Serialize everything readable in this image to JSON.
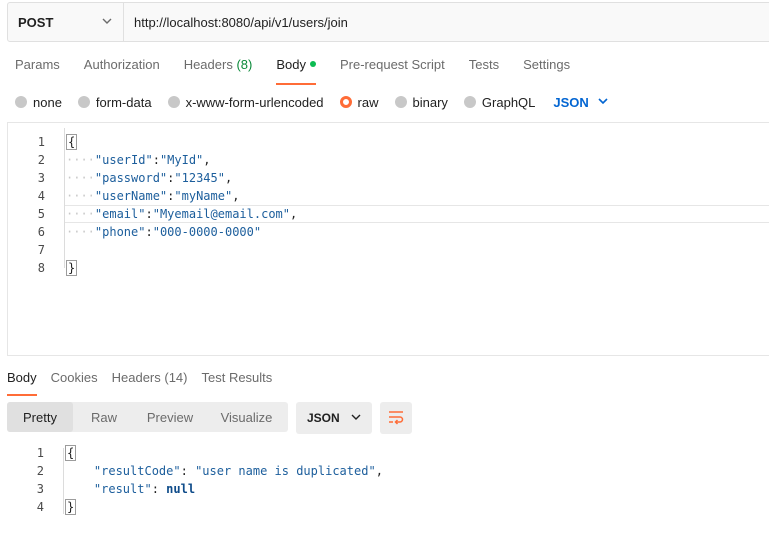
{
  "request": {
    "method": "POST",
    "url": "http://localhost:8080/api/v1/users/join"
  },
  "request_tabs": [
    {
      "label": "Params"
    },
    {
      "label": "Authorization"
    },
    {
      "label": "Headers",
      "count": "(8)"
    },
    {
      "label": "Body",
      "active": true,
      "dot": true
    },
    {
      "label": "Pre-request Script"
    },
    {
      "label": "Tests"
    },
    {
      "label": "Settings"
    }
  ],
  "body_types": [
    {
      "label": "none"
    },
    {
      "label": "form-data"
    },
    {
      "label": "x-www-form-urlencoded"
    },
    {
      "label": "raw",
      "selected": true
    },
    {
      "label": "binary"
    },
    {
      "label": "GraphQL"
    }
  ],
  "body_language": "JSON",
  "request_body": {
    "line_numbers": [
      "1",
      "2",
      "3",
      "4",
      "5",
      "6",
      "7",
      "8"
    ],
    "fields": [
      {
        "key": "\"userId\"",
        "value": "\"MyId\"",
        "comma": ","
      },
      {
        "key": "\"password\"",
        "value": "\"12345\"",
        "comma": ","
      },
      {
        "key": "\"userName\"",
        "value": "\"myName\"",
        "comma": ","
      },
      {
        "key": "\"email\"",
        "value": "\"Myemail@email.com\"",
        "comma": ","
      },
      {
        "key": "\"phone\"",
        "value": "\"000-0000-0000\"",
        "comma": ""
      }
    ],
    "open_brace": "{",
    "close_brace": "}"
  },
  "response_tabs": [
    {
      "label": "Body",
      "active": true
    },
    {
      "label": "Cookies"
    },
    {
      "label": "Headers (14)"
    },
    {
      "label": "Test Results"
    }
  ],
  "view_modes": [
    {
      "label": "Pretty",
      "active": true
    },
    {
      "label": "Raw"
    },
    {
      "label": "Preview"
    },
    {
      "label": "Visualize"
    }
  ],
  "response_format": "JSON",
  "response_body": {
    "line_numbers": [
      "1",
      "2",
      "3",
      "4"
    ],
    "open_brace": "{",
    "close_brace": "}",
    "fields": [
      {
        "key": "\"resultCode\"",
        "value": "\"user name is duplicated\"",
        "comma": ","
      },
      {
        "key": "\"result\"",
        "value": "null",
        "comma": ""
      }
    ]
  },
  "colors": {
    "accent": "#ff6c37",
    "link_blue": "#0265d2",
    "code_blue": "#1c5e9c",
    "green_dot": "#0cbb52"
  }
}
